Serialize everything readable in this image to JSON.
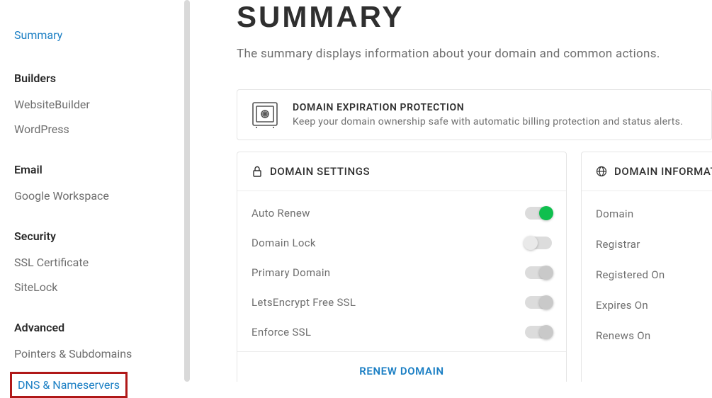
{
  "sidebar": {
    "active": "Summary",
    "sections": [
      {
        "heading": "Builders",
        "items": [
          "WebsiteBuilder",
          "WordPress"
        ]
      },
      {
        "heading": "Email",
        "items": [
          "Google Workspace"
        ]
      },
      {
        "heading": "Security",
        "items": [
          "SSL Certificate",
          "SiteLock"
        ]
      },
      {
        "heading": "Advanced",
        "items": [
          "Pointers & Subdomains",
          "DNS & Nameservers"
        ]
      }
    ]
  },
  "page": {
    "title": "SUMMARY",
    "subtitle": "The summary displays information about your domain and common actions."
  },
  "banner": {
    "title": "DOMAIN EXPIRATION PROTECTION",
    "text": "Keep your domain ownership safe with automatic billing protection and status alerts."
  },
  "settings_card": {
    "title": "DOMAIN SETTINGS",
    "items": [
      {
        "label": "Auto Renew",
        "state": "on"
      },
      {
        "label": "Domain Lock",
        "state": "off"
      },
      {
        "label": "Primary Domain",
        "state": "off-right"
      },
      {
        "label": "LetsEncrypt Free SSL",
        "state": "off-right"
      },
      {
        "label": "Enforce SSL",
        "state": "off-right"
      }
    ],
    "footer": "RENEW DOMAIN"
  },
  "info_card": {
    "title": "DOMAIN INFORMATIC",
    "items": [
      "Domain",
      "Registrar",
      "Registered On",
      "Expires On",
      "Renews On"
    ]
  }
}
